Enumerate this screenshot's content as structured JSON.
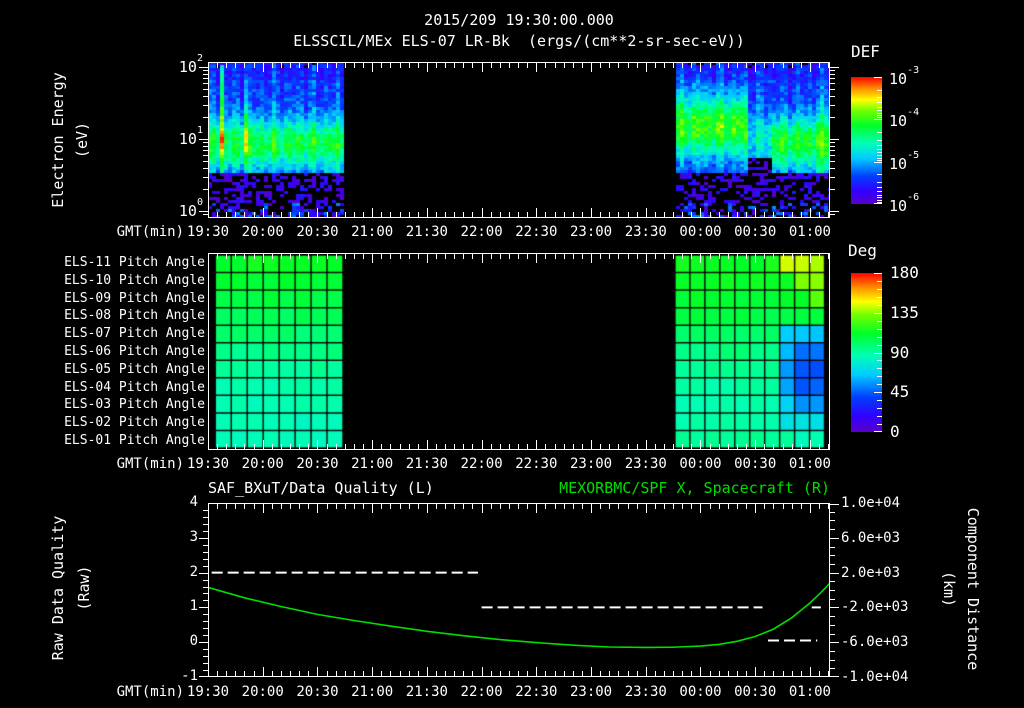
{
  "header": {
    "line1": "2015/209 19:30:00.000",
    "line2": "ELSSCIL/MEx ELS-07 LR-Bk  (ergs/(cm**2-sr-sec-eV))"
  },
  "time_axis": {
    "label": "GMT(min)",
    "ticks": [
      "19:30",
      "20:00",
      "20:30",
      "21:00",
      "21:30",
      "22:00",
      "22:30",
      "23:00",
      "23:30",
      "00:00",
      "00:30",
      "01:00"
    ],
    "major_every_min": 30,
    "minor_every_min": 5,
    "total_minutes": 341
  },
  "panel_spectrogram": {
    "ylabel": "Electron Energy",
    "yunit": "(eV)",
    "ytick_exponents": [
      "2",
      "1",
      "0"
    ],
    "colorbar": {
      "title": "DEF",
      "tick_exponents": [
        "-3",
        "-4",
        "-5",
        "-6"
      ]
    }
  },
  "panel_pitch": {
    "row_labels": [
      "ELS-11 Pitch Angle",
      "ELS-10 Pitch Angle",
      "ELS-09 Pitch Angle",
      "ELS-08 Pitch Angle",
      "ELS-07 Pitch Angle",
      "ELS-06 Pitch Angle",
      "ELS-05 Pitch Angle",
      "ELS-04 Pitch Angle",
      "ELS-03 Pitch Angle",
      "ELS-02 Pitch Angle",
      "ELS-01 Pitch Angle"
    ],
    "colorbar": {
      "title": "Deg",
      "ticks": [
        "180",
        "135",
        "90",
        "45",
        "0"
      ]
    }
  },
  "panel_line": {
    "title_left": "SAF_BXuT/Data Quality (L)",
    "title_right": "MEXORBMC/SPF X, Spacecraft (R)",
    "ylabel_left": "Raw Data Quality",
    "yunit_left": "(Raw)",
    "yticks_left": [
      "4",
      "3",
      "2",
      "1",
      "0",
      "-1"
    ],
    "ylabel_right": "Component Distance",
    "yunit_right": "(km)",
    "yticks_right": [
      "1.0e+04",
      "6.0e+03",
      "2.0e+03",
      "-2.0e+03",
      "-6.0e+03",
      "-1.0e+04"
    ]
  },
  "colors": {
    "background": "#000000",
    "text": "#ffffff",
    "accent_green": "#00dd00",
    "frame": "#ffffff",
    "rainbow_stops": [
      [
        0,
        "#5a00c8"
      ],
      [
        0.1,
        "#3200ff"
      ],
      [
        0.22,
        "#0040ff"
      ],
      [
        0.36,
        "#00ccff"
      ],
      [
        0.48,
        "#00ffb4"
      ],
      [
        0.62,
        "#00ff28"
      ],
      [
        0.74,
        "#78ff00"
      ],
      [
        0.82,
        "#ffff00"
      ],
      [
        0.91,
        "#ff8c00"
      ],
      [
        1,
        "#ff0000"
      ]
    ]
  },
  "chart_data": [
    {
      "type": "heatmap",
      "panel": "electron-energy-spectrogram",
      "title": "ELSSCIL/MEx ELS-07 LR-Bk",
      "units": "ergs/(cm**2-sr-sec-eV)",
      "xlabel": "GMT(min)",
      "x_ticks": [
        "19:30",
        "20:00",
        "20:30",
        "21:00",
        "21:30",
        "22:00",
        "22:30",
        "23:00",
        "23:30",
        "00:00",
        "00:30",
        "01:00"
      ],
      "ylabel": "Electron Energy (eV)",
      "y_scale": "log",
      "y_ticks": [
        "10^0",
        "10^1",
        "10^2"
      ],
      "colorbar": {
        "title": "DEF",
        "ticks": [
          "10^-3",
          "10^-4",
          "10^-5",
          "10^-6"
        ],
        "range_log10": [
          -6,
          -3
        ]
      },
      "data_regions": [
        {
          "t_min": 1,
          "t_max": 74,
          "band_center_eV": 8.5,
          "band_peak_log10_def": -4.2,
          "background_log10_def": -5.4,
          "note": "blue background above band, purple speckle noise below ~3 eV, bright vertical enhancement near 19:38 and 19:51"
        },
        {
          "t_min": 256,
          "t_max": 341,
          "band_center_eV": 15,
          "band_peak_log10_def": -4.0,
          "background_log10_def": -5.4,
          "note": "bright band until ~00:27, dim gap 00:27-00:38, band resumes near 9 eV through end"
        }
      ],
      "gap": "no data between 20:45 and 23:46"
    },
    {
      "type": "heatmap",
      "panel": "pitch-angle-grid",
      "rows": [
        "ELS-11",
        "ELS-10",
        "ELS-09",
        "ELS-08",
        "ELS-07",
        "ELS-06",
        "ELS-05",
        "ELS-04",
        "ELS-03",
        "ELS-02",
        "ELS-01"
      ],
      "colorbar": {
        "title": "Deg",
        "ticks": [
          180,
          135,
          90,
          45,
          0
        ]
      },
      "left_block": {
        "t_min": 4,
        "t_max": 74,
        "columns": 8,
        "row_mean_deg": [
          113,
          110,
          107,
          103,
          99,
          95,
          91,
          88,
          86,
          85,
          84
        ]
      },
      "right_block": {
        "t_min": 256,
        "t_max": 338,
        "columns": 10,
        "row_mean_deg": [
          114,
          112,
          110,
          106,
          101,
          96,
          92,
          89,
          87,
          88,
          92
        ],
        "cell_overrides_deg": [
          [
            0,
            7,
            9,
            141
          ],
          [
            1,
            8,
            9,
            133
          ],
          [
            2,
            9,
            9,
            126
          ],
          [
            4,
            7,
            9,
            66
          ],
          [
            5,
            7,
            7,
            62
          ],
          [
            5,
            8,
            9,
            48
          ],
          [
            6,
            7,
            7,
            56
          ],
          [
            6,
            8,
            9,
            43
          ],
          [
            7,
            7,
            7,
            58
          ],
          [
            7,
            8,
            9,
            44
          ],
          [
            8,
            7,
            7,
            68
          ],
          [
            8,
            8,
            9,
            55
          ],
          [
            9,
            7,
            9,
            72
          ],
          [
            10,
            8,
            9,
            86
          ]
        ]
      }
    },
    {
      "type": "line",
      "panel": "quality-and-distance",
      "xlabel": "GMT(min)",
      "ylim_left": [
        -1,
        4
      ],
      "ylabel_left": "Raw Data Quality (Raw)",
      "ylim_right": [
        -10000,
        10000
      ],
      "ylabel_right": "Component Distance (km)",
      "series": [
        {
          "name": "SAF_BXuT/Data Quality (L)",
          "axis": "left",
          "style": "dashed",
          "color": "#ffffff",
          "segments": [
            {
              "t": [
                2,
                148
              ],
              "value": 2
            },
            {
              "t": [
                150,
                304
              ],
              "value": 1
            },
            {
              "t": [
                307,
                334
              ],
              "value": 0.05
            },
            {
              "t": [
                331,
                336
              ],
              "value": 1
            }
          ]
        },
        {
          "name": "MEXORBMC/SPF X, Spacecraft (R)",
          "axis": "right",
          "style": "solid",
          "color": "#00dd00",
          "points_t_km": [
            [
              0,
              300
            ],
            [
              20,
              -900
            ],
            [
              40,
              -1900
            ],
            [
              60,
              -2800
            ],
            [
              80,
              -3500
            ],
            [
              100,
              -4150
            ],
            [
              120,
              -4750
            ],
            [
              140,
              -5250
            ],
            [
              160,
              -5700
            ],
            [
              180,
              -6050
            ],
            [
              200,
              -6350
            ],
            [
              220,
              -6550
            ],
            [
              240,
              -6600
            ],
            [
              255,
              -6580
            ],
            [
              270,
              -6450
            ],
            [
              280,
              -6250
            ],
            [
              290,
              -5900
            ],
            [
              300,
              -5350
            ],
            [
              310,
              -4500
            ],
            [
              320,
              -3200
            ],
            [
              330,
              -1500
            ],
            [
              336,
              -300
            ],
            [
              341,
              800
            ]
          ]
        }
      ]
    }
  ]
}
